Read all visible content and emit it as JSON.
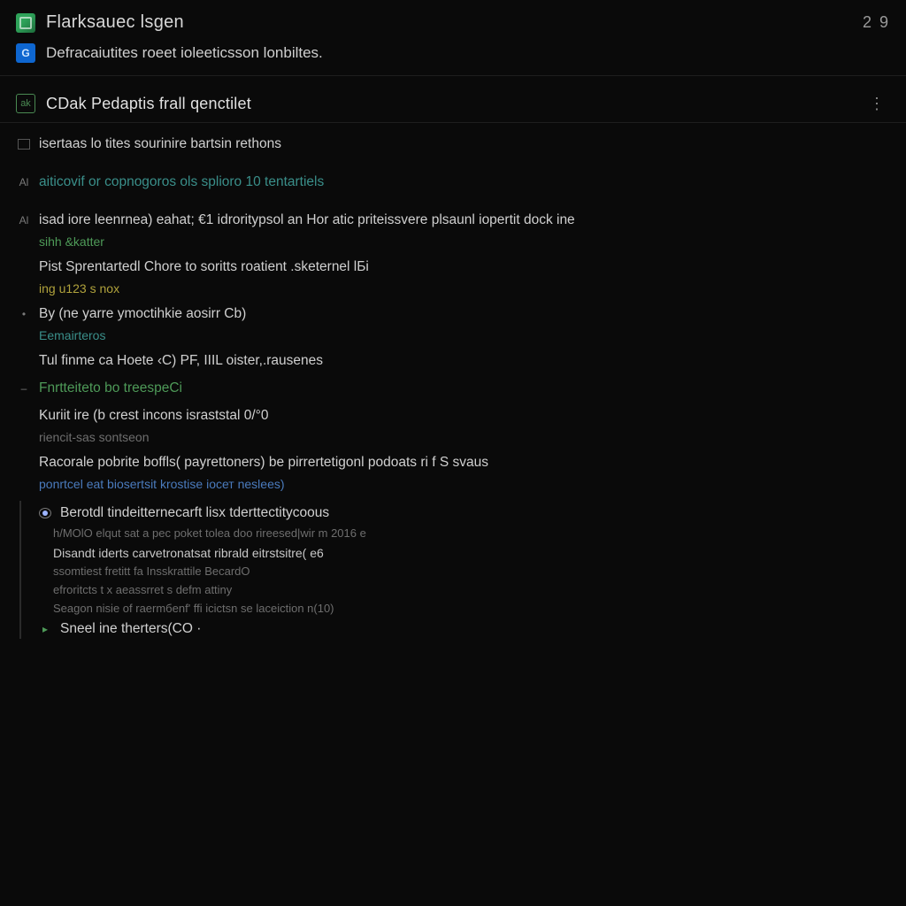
{
  "titlebar": {
    "title": "Flarksauec lsgen",
    "counter": "2 9"
  },
  "subtitlebar": {
    "icon_label": "G",
    "text": "Defracaiutites roeet ioleeticsson lonbiltes."
  },
  "section": {
    "icon_label": "ak",
    "title": "CDak Pedaptis frall qenctilet",
    "menu": "⋮"
  },
  "rows": [
    {
      "bullet": "box",
      "main": "isertaas lo tites sourinire bartsin rethons"
    },
    {
      "bullet": "text",
      "bullet_text": "Al",
      "main": "aiticovif or copnogoros ols splioro 10 tentartiels",
      "main_class": "c-teal"
    },
    {
      "bullet": "text",
      "bullet_text": "Al",
      "main": "isad iore leenrnea) eahat; €1 idroritypsol an Hor atic priteissvere plsaunl iopertit dock ine",
      "sub": "sihh &katter",
      "sub_class": "c-green"
    },
    {
      "bullet": "none",
      "main": "Pist Sprentartedl Chore to soritts roatient .sketernel lБi",
      "sub": "ing u123 s nox",
      "sub_class": "c-yellow"
    },
    {
      "bullet": "dot",
      "main": "By (ne yarre ymoctihkie aosirr Cb)",
      "sub": "Eemairteros",
      "sub_class": "c-teal"
    },
    {
      "bullet": "none",
      "main": "Tul finme ca Hoete ‹C) PF, IIIL oister,.rausenes"
    },
    {
      "bullet": "text",
      "bullet_text": "–",
      "main": "Fnrtteiteto bo treespeCi",
      "main_class": "c-green"
    },
    {
      "bullet": "none",
      "main": "Kuriit ire (b crest incons israststal 0/°0",
      "sub": "riencit-sas sontseon",
      "sub_class": "c-dim"
    },
    {
      "bullet": "none",
      "main": "Racorale pobrite boffls( payrettoners) be pirrertetigonl podoats ri f S svaus",
      "sub": "ponrtcel eat biosertsit krostise ioсет neslees)",
      "sub_class": "c-link"
    }
  ],
  "block": {
    "lead_bullet": "radio_on",
    "lead": "Berotdl tindeitternecarft lisx tderttectitycoous",
    "lines": [
      {
        "text": "h/MOlO elqut sat а рeс poket tolea doo rireesed|wir m 2016 e",
        "class": "c-dim small"
      },
      {
        "text": "Disandt iderts carvetronatsat ribrald eitrstsitre( e6",
        "class": ""
      },
      {
        "text": "ssomtiest fretitt fa Insskrattile BecardO",
        "class": "c-dim small"
      },
      {
        "text": "efroritcts t x aeassrret s defm attiny",
        "class": "c-dim small"
      },
      {
        "text": "Seagon nisie of raermбenf' ffi icictsn se laceiction n(10)",
        "class": "c-dim small"
      }
    ],
    "footer_bullet": "▸",
    "footer": "Sneel ine therters(CO ·"
  }
}
